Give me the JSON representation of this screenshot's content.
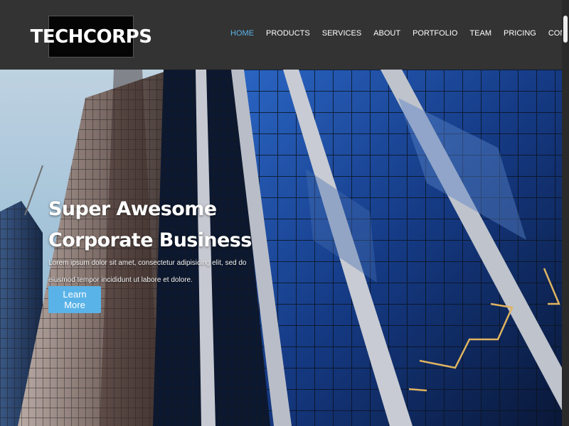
{
  "brand": {
    "logo_text": "TECHCORPS"
  },
  "nav": {
    "items": [
      {
        "label": "HOME",
        "active": true
      },
      {
        "label": "PRODUCTS"
      },
      {
        "label": "SERVICES"
      },
      {
        "label": "ABOUT"
      },
      {
        "label": "PORTFOLIO"
      },
      {
        "label": "TEAM"
      },
      {
        "label": "PRICING"
      },
      {
        "label": "CONTACT"
      }
    ]
  },
  "hero": {
    "title": "Super Awesome Corporate Business",
    "text": "Lorem ipsum dolor sit amet, consectetur adipisicing elit, sed do eiusmod tempor incididunt ut labore et dolore.",
    "cta_label": "Learn More",
    "background": "skyscraper-photo"
  },
  "colors": {
    "accent": "#5ab3e8",
    "header_bg": "#333333",
    "logo_bg": "#050505"
  }
}
